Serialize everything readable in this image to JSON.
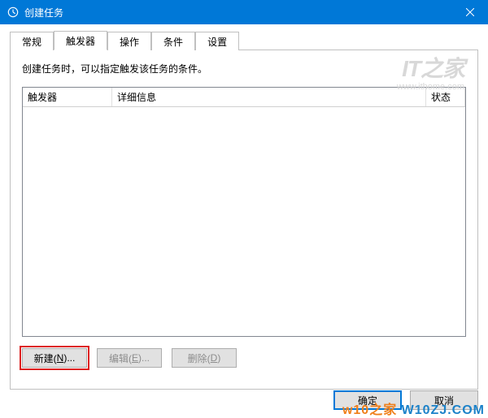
{
  "window": {
    "title": "创建任务"
  },
  "tabs": {
    "items": [
      {
        "label": "常规"
      },
      {
        "label": "触发器",
        "active": true
      },
      {
        "label": "操作"
      },
      {
        "label": "条件"
      },
      {
        "label": "设置"
      }
    ]
  },
  "page": {
    "description": "创建任务时，可以指定触发该任务的条件。"
  },
  "columns": {
    "trigger": "触发器",
    "detail": "详细信息",
    "status": "状态"
  },
  "buttons": {
    "new_prefix": "新建(",
    "new_hotkey": "N",
    "new_suffix": ")...",
    "edit_prefix": "编辑(",
    "edit_hotkey": "E",
    "edit_suffix": ")...",
    "delete_prefix": "删除(",
    "delete_hotkey": "D",
    "delete_suffix": ")"
  },
  "dialog": {
    "ok": "确定",
    "cancel": "取消"
  },
  "watermark": {
    "big": "IT之家",
    "small": "www.ithome.com"
  },
  "footer": {
    "a": "w10之家 ",
    "b": "W10ZJ.COM"
  }
}
